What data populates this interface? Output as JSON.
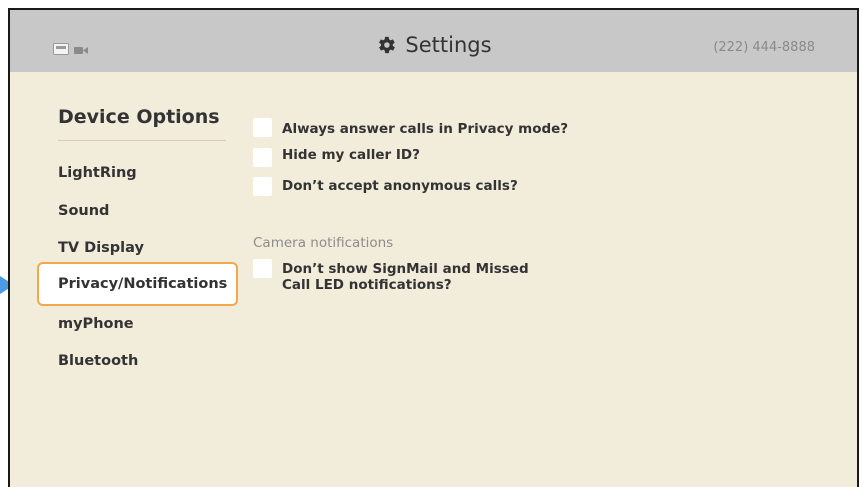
{
  "topbar": {
    "title": "Settings",
    "phone": "(222) 444-8888",
    "icons": [
      "ethernet-icon",
      "camera-icon",
      "gear-icon"
    ]
  },
  "sidebar": {
    "heading": "Device Options",
    "items": [
      {
        "label": "LightRing",
        "selected": false
      },
      {
        "label": "Sound",
        "selected": false
      },
      {
        "label": "TV Display",
        "selected": false
      },
      {
        "label": "Privacy/Notifications",
        "selected": true
      },
      {
        "label": "myPhone",
        "selected": false
      },
      {
        "label": "Bluetooth",
        "selected": false
      }
    ]
  },
  "options": [
    {
      "label": "Always answer calls in Privacy mode?",
      "checked": false
    },
    {
      "label": "Hide my caller ID?",
      "checked": false
    },
    {
      "label": "Don’t accept anonymous calls?",
      "checked": false
    }
  ],
  "camera_section": {
    "label": "Camera notifications",
    "options": [
      {
        "label": "Don’t show SignMail and Missed Call LED notifications?",
        "checked": false
      }
    ]
  },
  "colors": {
    "background": "#f2ecdb",
    "topbar": "#c8c8c8",
    "selection_border": "#f1a84e",
    "pointer": "#4a9be4"
  }
}
